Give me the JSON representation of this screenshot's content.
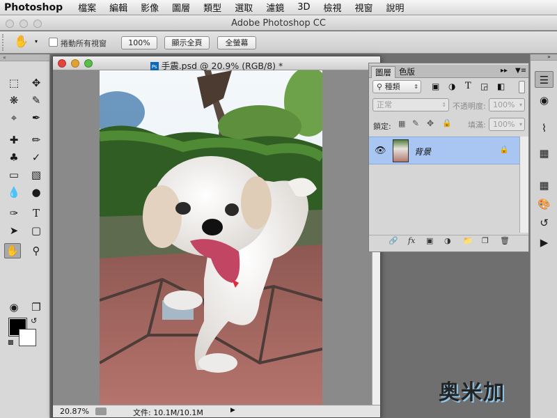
{
  "menubar": {
    "app_name": "Photoshop",
    "items": [
      "檔案",
      "編輯",
      "影像",
      "圖層",
      "類型",
      "選取",
      "濾鏡",
      "3D",
      "檢視",
      "視窗",
      "說明"
    ]
  },
  "window": {
    "title": "Adobe Photoshop CC"
  },
  "options_bar": {
    "scroll_all_windows_label": "捲動所有視窗",
    "zoom_100_label": "100%",
    "fit_screen_label": "顯示全頁",
    "fill_screen_label": "全螢幕"
  },
  "document": {
    "title": "手震.psd @ 20.9% (RGB/8) *",
    "zoom": "20.87%",
    "file_info": "文件: 10.1M/10.1M"
  },
  "layers_panel": {
    "tabs": [
      "圖層",
      "色版"
    ],
    "active_tab": "圖層",
    "filter_label": "種類",
    "blend_mode": "正常",
    "opacity_label": "不透明度:",
    "opacity_value": "100%",
    "lock_label": "鎖定:",
    "fill_label": "填滿:",
    "fill_value": "100%",
    "layers": [
      {
        "name": "背景",
        "locked": true,
        "visible": true
      }
    ]
  },
  "watermark": "奥米加",
  "colors": {
    "selection": "#a9c6f2",
    "foreground": "#000000",
    "background": "#ffffff",
    "close_button": "#e0443e",
    "minimize_button": "#dea236",
    "zoom_button": "#5bbd4c"
  }
}
